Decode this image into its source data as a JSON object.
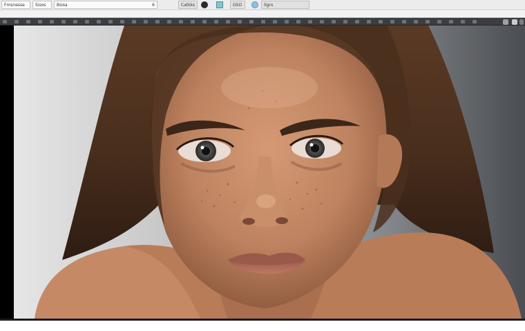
{
  "toolbar": {
    "field_1": "Fmsnesse",
    "field_2": "Sisos",
    "field_3": "Bsisa",
    "field_3_suffix": "6",
    "button_1": "Catkks",
    "button_2": "GSO",
    "button_3": "Sgrs"
  },
  "icons": {
    "toolbar_1": "dark-circle-icon",
    "toolbar_2": "teal-square-icon",
    "toolbar_3": "blue-circle-icon"
  },
  "colors": {
    "toolbar_bg": "#ececec",
    "header_bar": "#3b3d40",
    "canvas_bg": "#000000",
    "backdrop_light": "#d9d9d9",
    "backdrop_dark": "#4d5054",
    "hair": "#4a2e1c",
    "skin": "#c68c68"
  }
}
